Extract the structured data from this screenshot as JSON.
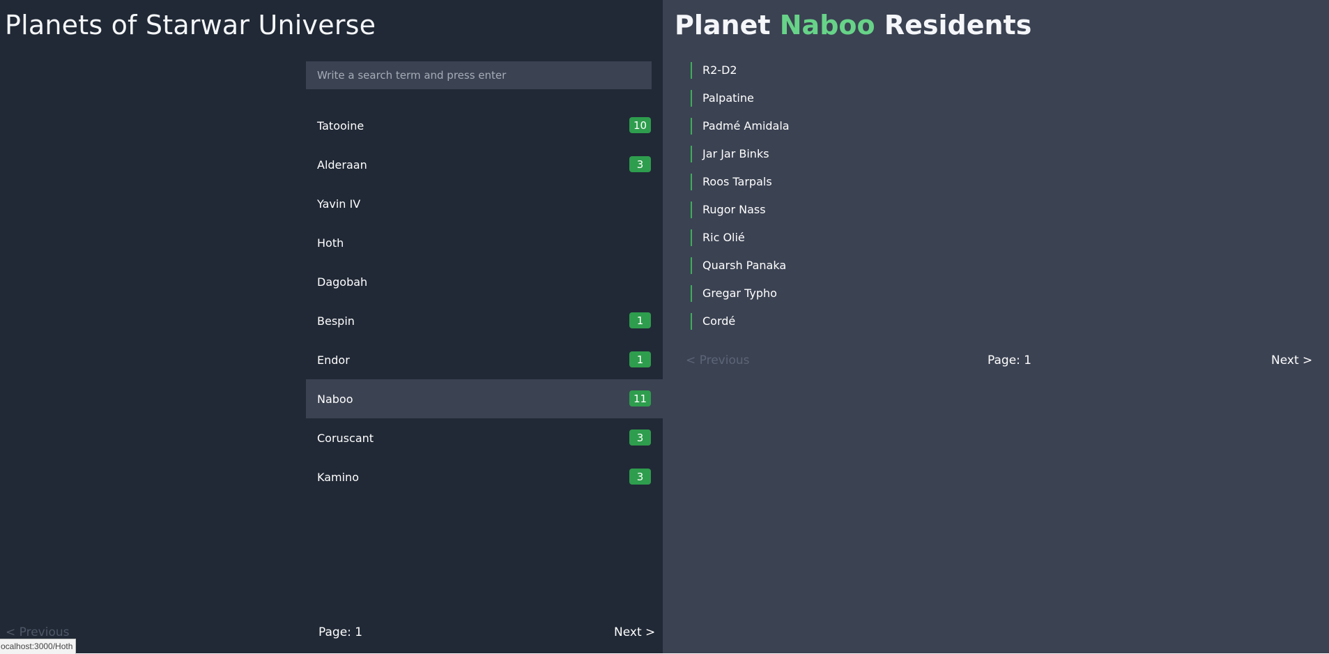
{
  "left": {
    "title": "Planets of Starwar Universe",
    "search_placeholder": "Write a search term and press enter",
    "planets": [
      {
        "name": "Tatooine",
        "count": "10",
        "active": false
      },
      {
        "name": "Alderaan",
        "count": "3",
        "active": false
      },
      {
        "name": "Yavin IV",
        "count": "",
        "active": false
      },
      {
        "name": "Hoth",
        "count": "",
        "active": false
      },
      {
        "name": "Dagobah",
        "count": "",
        "active": false
      },
      {
        "name": "Bespin",
        "count": "1",
        "active": false
      },
      {
        "name": "Endor",
        "count": "1",
        "active": false
      },
      {
        "name": "Naboo",
        "count": "11",
        "active": true
      },
      {
        "name": "Coruscant",
        "count": "3",
        "active": false
      },
      {
        "name": "Kamino",
        "count": "3",
        "active": false
      }
    ],
    "pagination": {
      "prev": "< Previous",
      "page": "Page: 1",
      "next": "Next >"
    },
    "status_url": "ocalhost:3000/Hoth"
  },
  "right": {
    "title_prefix": "Planet",
    "title_planet": "Naboo",
    "title_suffix": "Residents",
    "residents": [
      "R2-D2",
      "Palpatine",
      "Padmé Amidala",
      "Jar Jar Binks",
      "Roos Tarpals",
      "Rugor Nass",
      "Ric Olié",
      "Quarsh Panaka",
      "Gregar Typho",
      "Cordé"
    ],
    "pagination": {
      "prev": "< Previous",
      "page": "Page: 1",
      "next": "Next >"
    }
  },
  "colors": {
    "left_bg": "#212936",
    "right_bg": "#3b4252",
    "accent_green": "#67d388",
    "badge_green": "#2e9d4d"
  }
}
